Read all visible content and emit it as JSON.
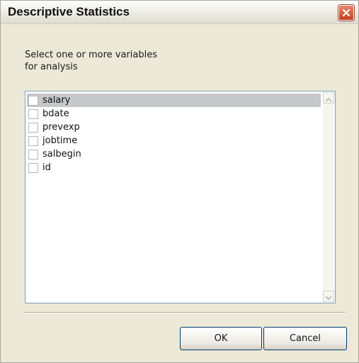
{
  "dialog": {
    "title": "Descriptive Statistics"
  },
  "prompt": "Select one or more variables\nfor analysis",
  "variables": [
    {
      "label": "salary",
      "selected": true
    },
    {
      "label": "bdate",
      "selected": false
    },
    {
      "label": "prevexp",
      "selected": false
    },
    {
      "label": "jobtime",
      "selected": false
    },
    {
      "label": "salbegin",
      "selected": false
    },
    {
      "label": "id",
      "selected": false
    }
  ],
  "buttons": {
    "ok": "OK",
    "cancel": "Cancel"
  },
  "icons": {
    "close": "close-icon",
    "up": "scroll-up-arrow-icon",
    "down": "scroll-down-arrow-icon"
  }
}
